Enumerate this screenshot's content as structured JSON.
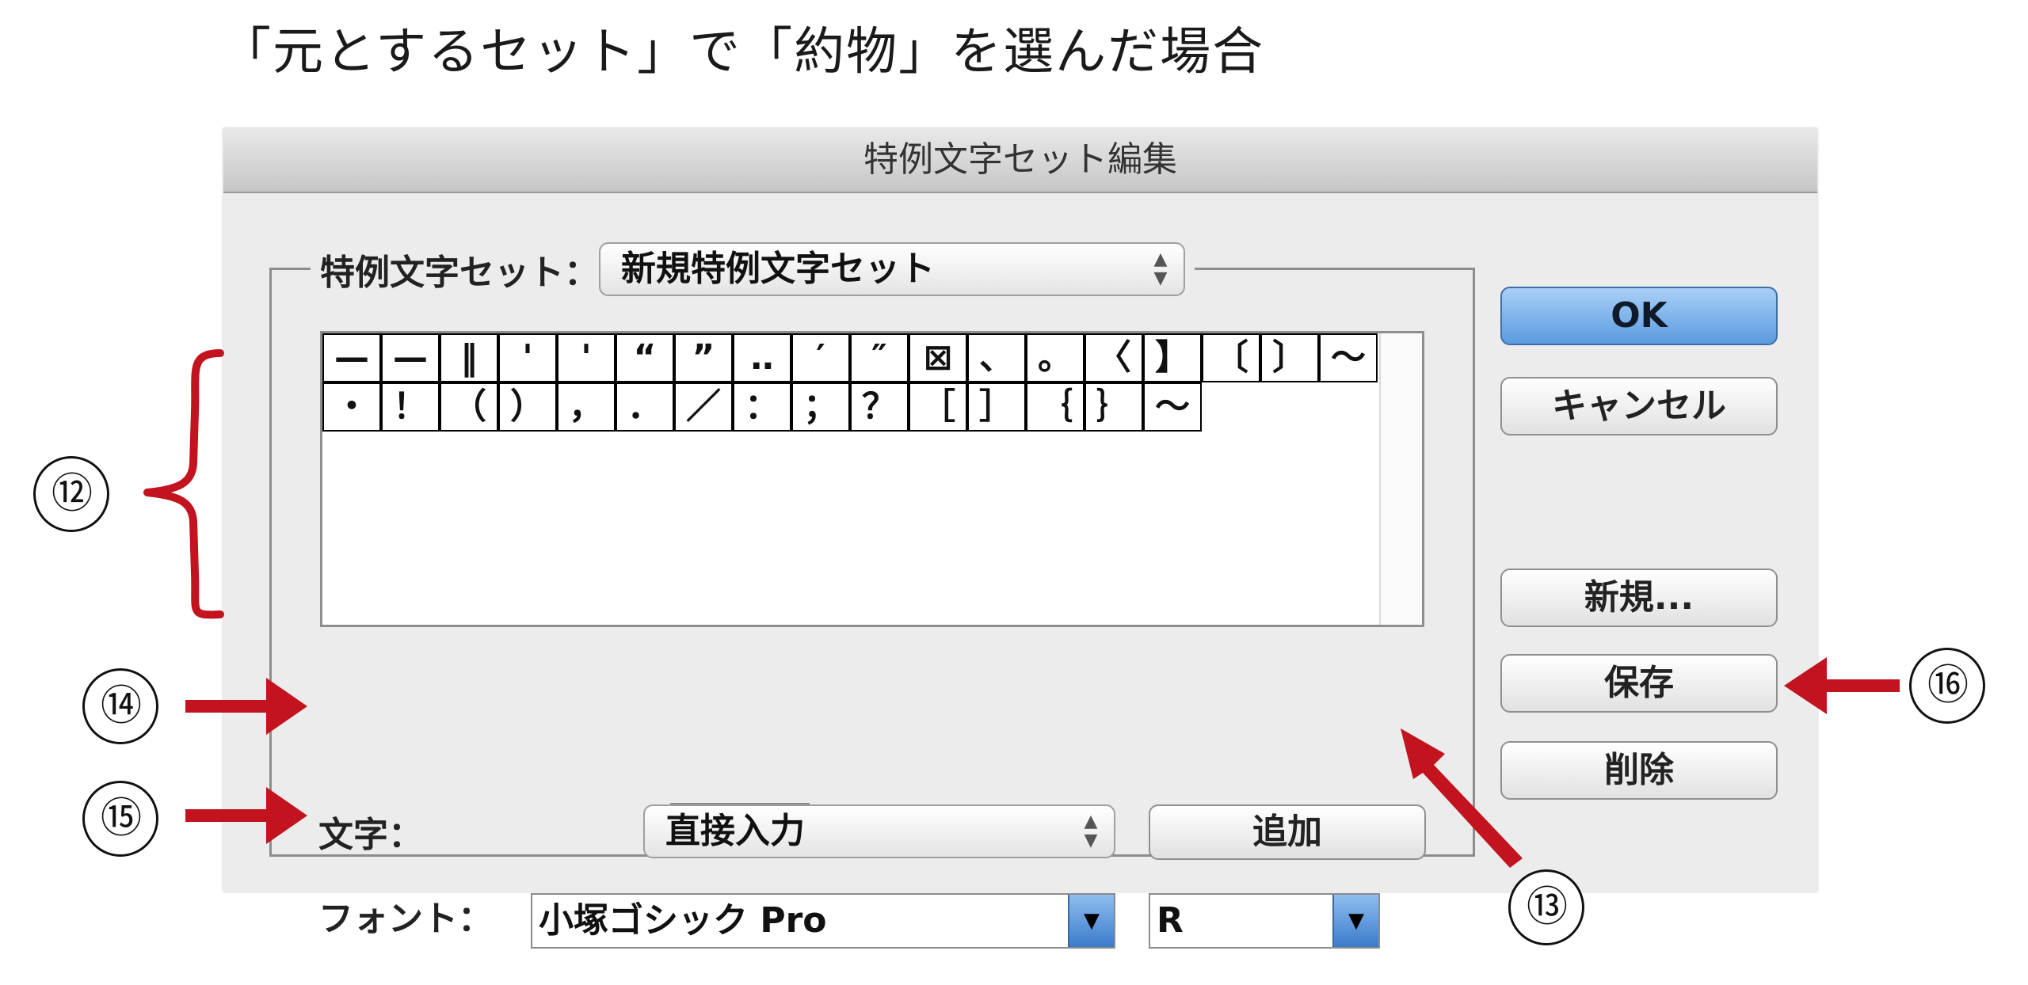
{
  "caption": "「元とするセット」で「約物」を選んだ場合",
  "window": {
    "title": "特例文字セット編集"
  },
  "set_selector": {
    "label": "特例文字セット：",
    "value": "新規特例文字セット"
  },
  "grid": {
    "row1": [
      "—",
      "—",
      "‖",
      "'",
      "'",
      "“",
      "”",
      "‥",
      "′",
      "″",
      "⊠",
      "、",
      "。",
      "〈",
      "】",
      "〔",
      "〕",
      "〜"
    ],
    "row2": [
      "・",
      "！",
      "（",
      "）",
      "，",
      "．",
      "／",
      "：",
      "；",
      "？",
      "［",
      "］",
      "｛",
      "｝",
      "〜"
    ]
  },
  "character_row": {
    "label": "文字：",
    "input_value": "",
    "input_mode_value": "直接入力",
    "add_button": "追加"
  },
  "font_row": {
    "label": "フォント：",
    "font_family": "小塚ゴシック Pro",
    "font_style": "R"
  },
  "buttons": {
    "ok": "OK",
    "cancel": "キャンセル",
    "new": "新規...",
    "save": "保存",
    "delete": "削除"
  },
  "annotations": {
    "n12": "⑫",
    "n13": "⑬",
    "n14": "⑭",
    "n15": "⑮",
    "n16": "⑯",
    "color": "#c2131f"
  }
}
